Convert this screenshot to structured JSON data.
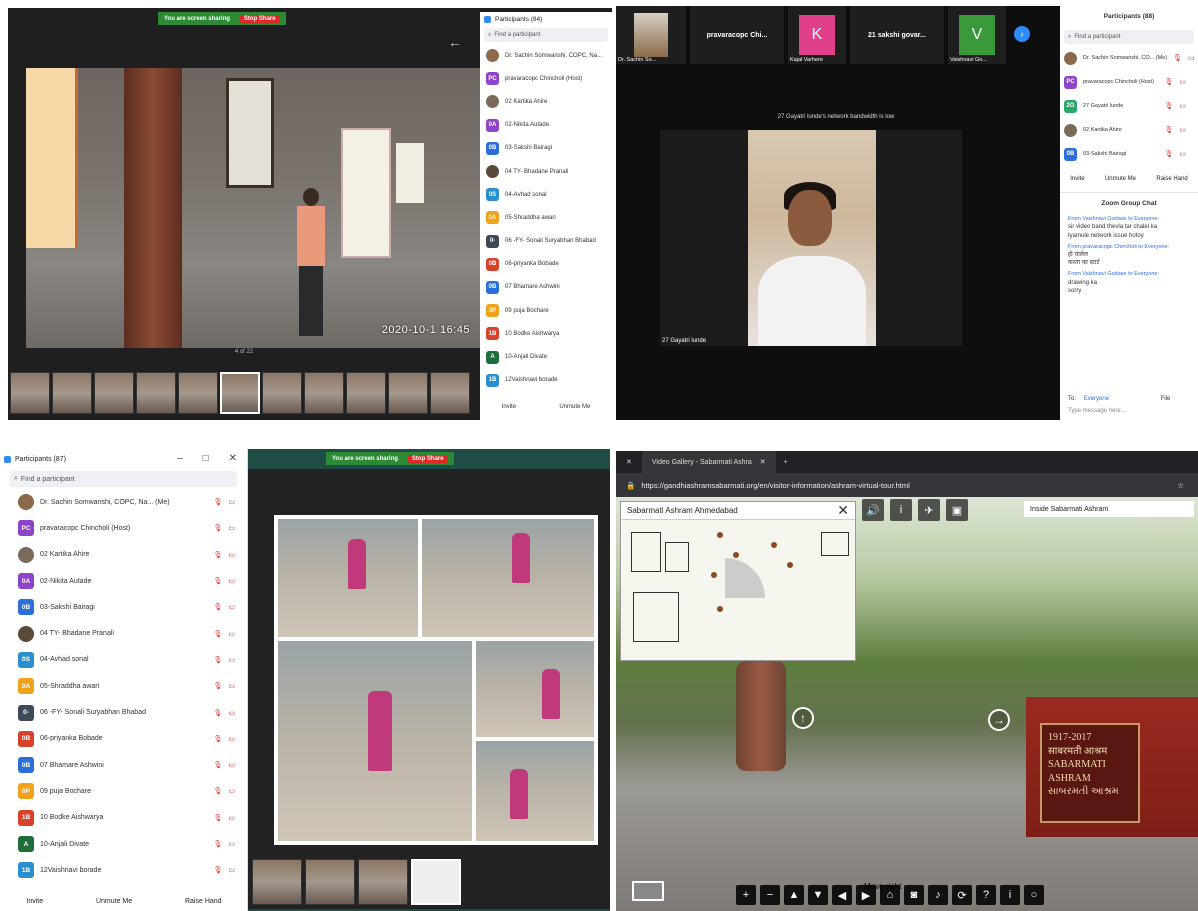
{
  "q1": {
    "share_text": "You are screen sharing",
    "stop_share": "Stop Share",
    "timestamp": "2020-10-1 16:45",
    "slide_counter": "4 of 22",
    "panel_title": "Participants (84)",
    "search_placeholder": "Find a participant",
    "participants": [
      {
        "initials": "",
        "name": "Dr. Sachin Somwanshi, COPC, Na...",
        "color": "#8a6a4a",
        "photo": true
      },
      {
        "initials": "PC",
        "name": "pravaracopc Chincholi (Host)",
        "color": "#8e44c9"
      },
      {
        "initials": "",
        "name": "02 Kartika Ahire",
        "color": "#7a6a5a",
        "photo": true
      },
      {
        "initials": "0A",
        "name": "02-Nikita Autade",
        "color": "#8e44c9"
      },
      {
        "initials": "0B",
        "name": "03-Sakshi Bairagi",
        "color": "#2d6fd8"
      },
      {
        "initials": "",
        "name": "04 TY- Bhadane Pranali",
        "color": "#5a4a3a",
        "photo": true
      },
      {
        "initials": "0S",
        "name": "04-Avhad sonal",
        "color": "#2b8fcf"
      },
      {
        "initials": "0A",
        "name": "05-Shraddha awari",
        "color": "#f0a21a"
      },
      {
        "initials": "0-",
        "name": "06 -FY- Sonali Suryabhan Bhabad",
        "color": "#3e4a5a"
      },
      {
        "initials": "0B",
        "name": "06-priyanka Bobade",
        "color": "#d8412a"
      },
      {
        "initials": "0B",
        "name": "07 Bhamare Ashwini",
        "color": "#2d6fd8"
      },
      {
        "initials": "0P",
        "name": "09 puja Bochare",
        "color": "#f0a21a"
      },
      {
        "initials": "1B",
        "name": "10 Bodke Aishwarya",
        "color": "#d8412a"
      },
      {
        "initials": "A",
        "name": "10-Anjali Divate",
        "color": "#1f6d3a"
      },
      {
        "initials": "1B",
        "name": "12Vaishnavi borade",
        "color": "#2b8fcf"
      }
    ],
    "invite": "Invite",
    "unmute": "Unmute Me"
  },
  "q2": {
    "tiles": [
      {
        "label": "Dr. Sachin So...",
        "kind": "photo"
      },
      {
        "label": "pravaracopc Chi...",
        "kind": "text"
      },
      {
        "label": "Kajal Varhere",
        "kind": "letter",
        "letter": "K",
        "color": "#e0408a"
      },
      {
        "label": "21 sakshi govar...",
        "kind": "text"
      },
      {
        "label": "Vaishnavi Go...",
        "kind": "letter",
        "letter": "V",
        "color": "#3a9a3a"
      }
    ],
    "bandwidth_msg": "27 Gayatri lunde's network bandwidth is low",
    "speaker_name": "27 Gayatri lunde",
    "panel_title": "Participants (88)",
    "search_placeholder": "Find a participant",
    "participants": [
      {
        "initials": "",
        "name": "Dr. Sachin Somwanshi, CO... (Me)",
        "color": "#8a6a4a",
        "photo": true
      },
      {
        "initials": "PC",
        "name": "pravaracopc Chincholi (Host)",
        "color": "#8e44c9"
      },
      {
        "initials": "2G",
        "name": "27 Gayatri lunde",
        "color": "#2aa86a"
      },
      {
        "initials": "",
        "name": "02 Kartika Ahire",
        "color": "#7a6a5a",
        "photo": true
      },
      {
        "initials": "0B",
        "name": "03-Sakshi Bairagi",
        "color": "#2d6fd8"
      }
    ],
    "invite": "Invite",
    "unmute": "Unmute Me",
    "raise_hand": "Raise Hand",
    "chat_title": "Zoom Group Chat",
    "chat": [
      {
        "from": "From Vaishnavi Godase to Everyone:",
        "lines": [
          "sir video band thevla tar chalel ka",
          "tyamule network issue hotoy"
        ]
      },
      {
        "from": "From pravaracopc Chincholi to Everyone:",
        "lines": [
          "हो चालेल",
          "करता का स्टार्ट"
        ]
      },
      {
        "from": "From Vaishnavi Godase to Everyone:",
        "lines": [
          "drawing ka",
          "sorry"
        ]
      }
    ],
    "to_label": "To:",
    "to_value": "Everyone",
    "file_label": "File",
    "type_placeholder": "Type message here..."
  },
  "q3": {
    "panel_title": "Participants (87)",
    "search_placeholder": "Find a participant",
    "share_text": "You are screen sharing",
    "stop_share": "Stop Share",
    "participants": [
      {
        "initials": "",
        "name": "Dr. Sachin Somwanshi, COPC, Na... (Me)",
        "color": "#8a6a4a",
        "photo": true
      },
      {
        "initials": "PC",
        "name": "pravaracopc Chincholi (Host)",
        "color": "#8e44c9"
      },
      {
        "initials": "",
        "name": "02 Kartika Ahire",
        "color": "#7a6a5a",
        "photo": true
      },
      {
        "initials": "0A",
        "name": "02-Nikita Autade",
        "color": "#8e44c9"
      },
      {
        "initials": "0B",
        "name": "03-Sakshi Bairagi",
        "color": "#2d6fd8"
      },
      {
        "initials": "",
        "name": "04 TY- Bhadane Pranali",
        "color": "#5a4a3a",
        "photo": true
      },
      {
        "initials": "0S",
        "name": "04-Avhad sonal",
        "color": "#2b8fcf"
      },
      {
        "initials": "0A",
        "name": "05-Shraddha awari",
        "color": "#f0a21a"
      },
      {
        "initials": "0-",
        "name": "06 -FY- Sonali Suryabhan Bhabad",
        "color": "#3e4a5a"
      },
      {
        "initials": "0B",
        "name": "06-priyanka Bobade",
        "color": "#d8412a"
      },
      {
        "initials": "0B",
        "name": "07 Bhamare Ashwini",
        "color": "#2d6fd8"
      },
      {
        "initials": "0P",
        "name": "09 puja Bochare",
        "color": "#f0a21a"
      },
      {
        "initials": "1B",
        "name": "10 Bodke Aishwarya",
        "color": "#d8412a"
      },
      {
        "initials": "A",
        "name": "10-Anjali Divate",
        "color": "#1f6d3a"
      },
      {
        "initials": "1B",
        "name": "12Vaishnavi borade",
        "color": "#2b8fcf"
      }
    ],
    "invite": "Invite",
    "unmute": "Unmute Me",
    "raise_hand": "Raise Hand"
  },
  "q4": {
    "tab_title": "Video Gallery - Sabarmati Ashra",
    "url": "https://gandhiashramsabarmati.org/en/visitor-information/ashram-virtual-tour.html",
    "map_title": "Sabarmati Ashram Ahmedabad",
    "location_select": "Inside Sabarmati Ashram",
    "sign_lines": [
      "1917-2017",
      "साबरमती आश्रम",
      "SABARMATI ASHRAM",
      "સાબરમતી આશ્રમ"
    ],
    "move_right": "Move right"
  }
}
